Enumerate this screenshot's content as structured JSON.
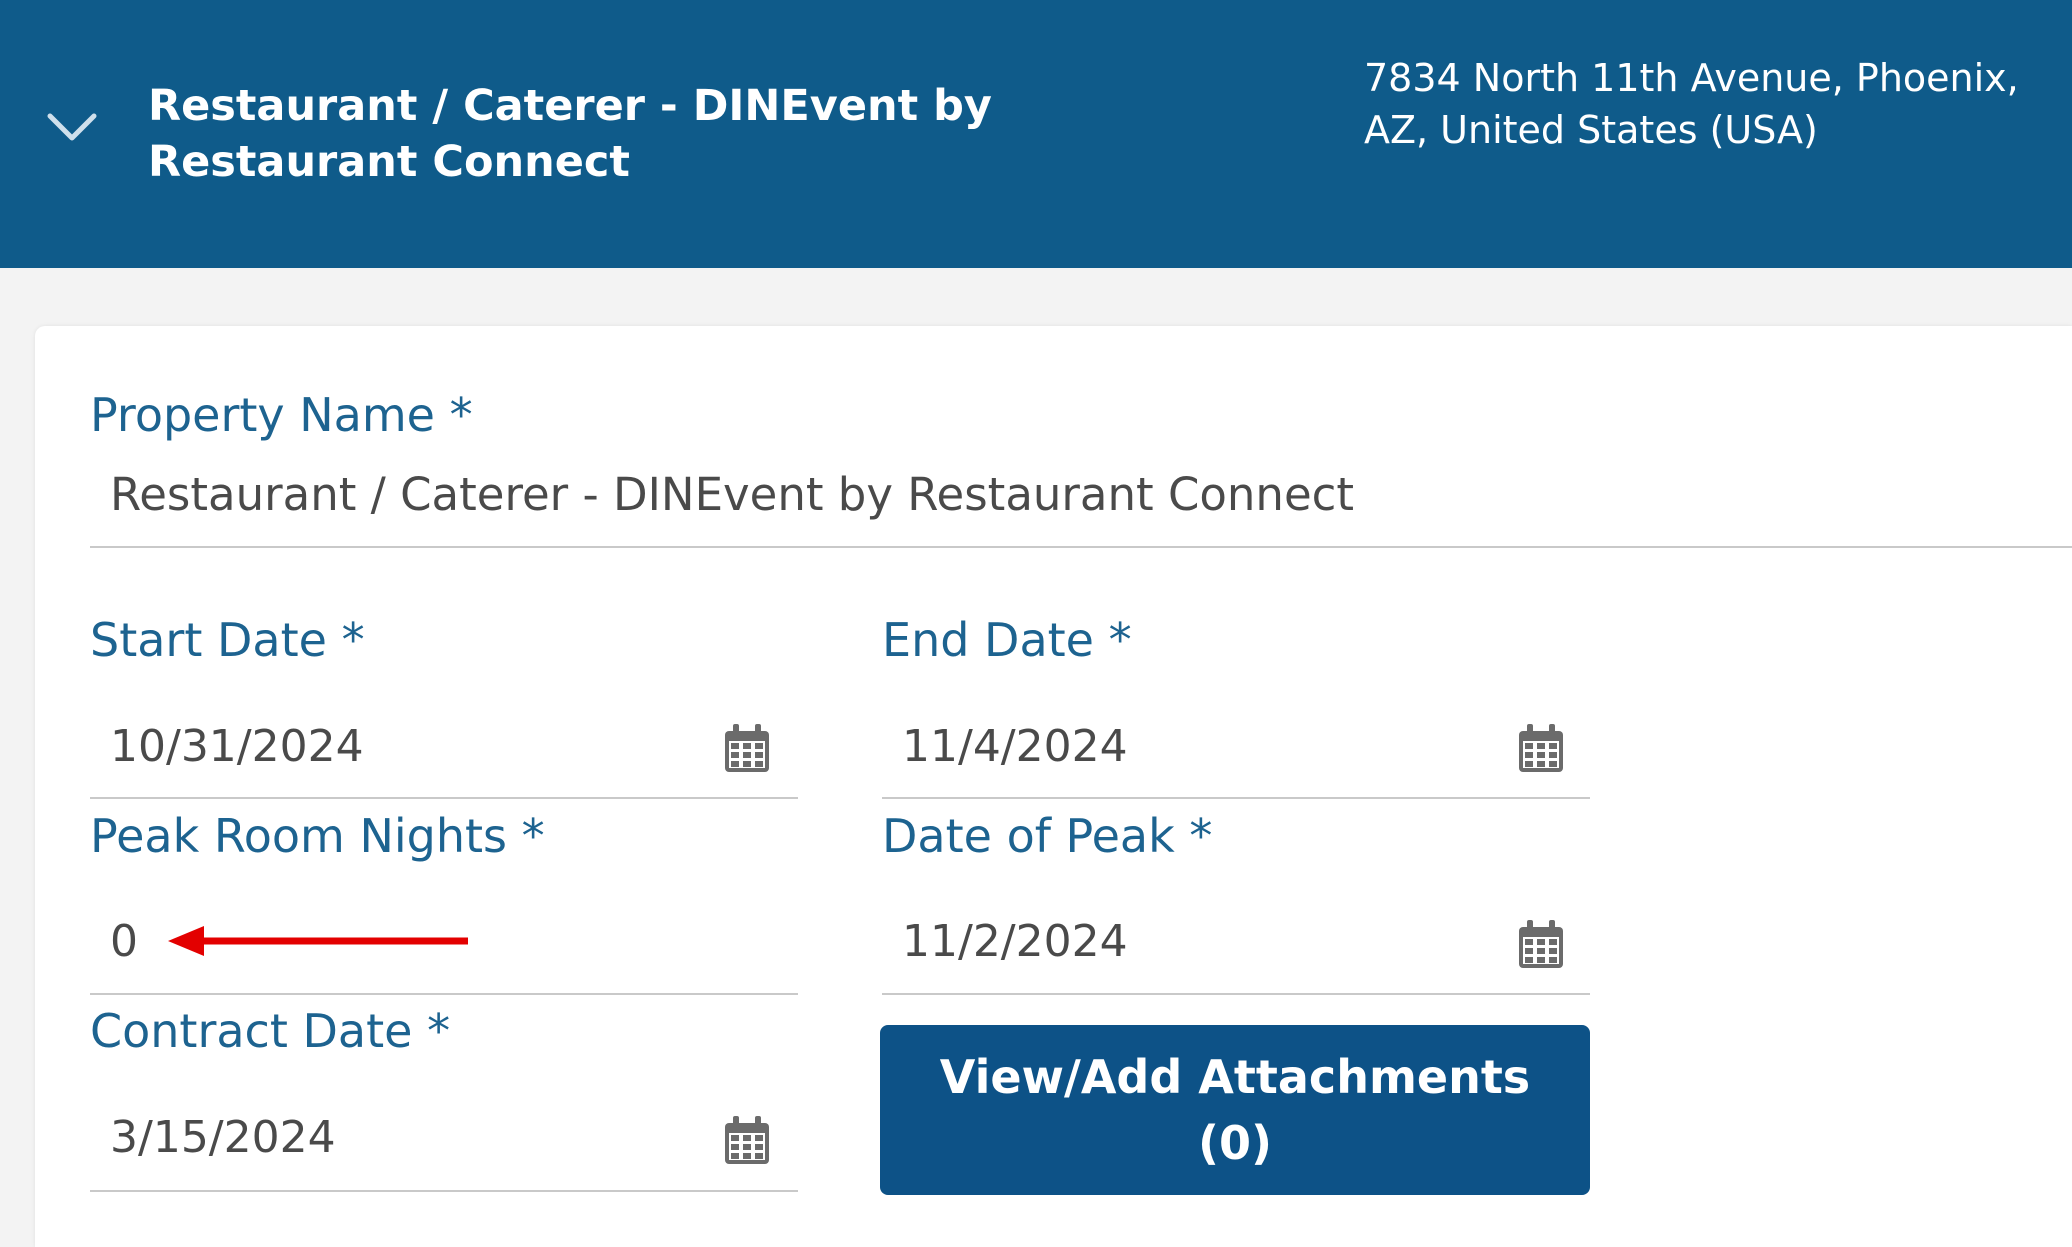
{
  "header": {
    "title": "Restaurant / Caterer - DINEvent by Restaurant Connect",
    "address": "7834 North 11th Avenue, Phoenix, AZ, United States (USA)",
    "background_color": "#0f5b8a"
  },
  "form": {
    "property_name": {
      "label": "Property Name *",
      "value": "Restaurant / Caterer -  DINEvent by Restaurant Connect"
    },
    "start_date": {
      "label": "Start Date *",
      "value": "10/31/2024",
      "icon": "calendar-icon"
    },
    "end_date": {
      "label": "End Date *",
      "value": "11/4/2024",
      "icon": "calendar-icon"
    },
    "peak_room_nights": {
      "label": "Peak Room Nights *",
      "value": "0"
    },
    "date_of_peak": {
      "label": "Date of Peak *",
      "value": "11/2/2024",
      "icon": "calendar-icon"
    },
    "contract_date": {
      "label": "Contract Date *",
      "value": "3/15/2024",
      "icon": "calendar-icon"
    },
    "attachments_button": {
      "line1": "View/Add Attachments",
      "line2": "(0)",
      "color": "#0d5287"
    }
  },
  "annotation": {
    "arrow_color": "#e30000"
  }
}
